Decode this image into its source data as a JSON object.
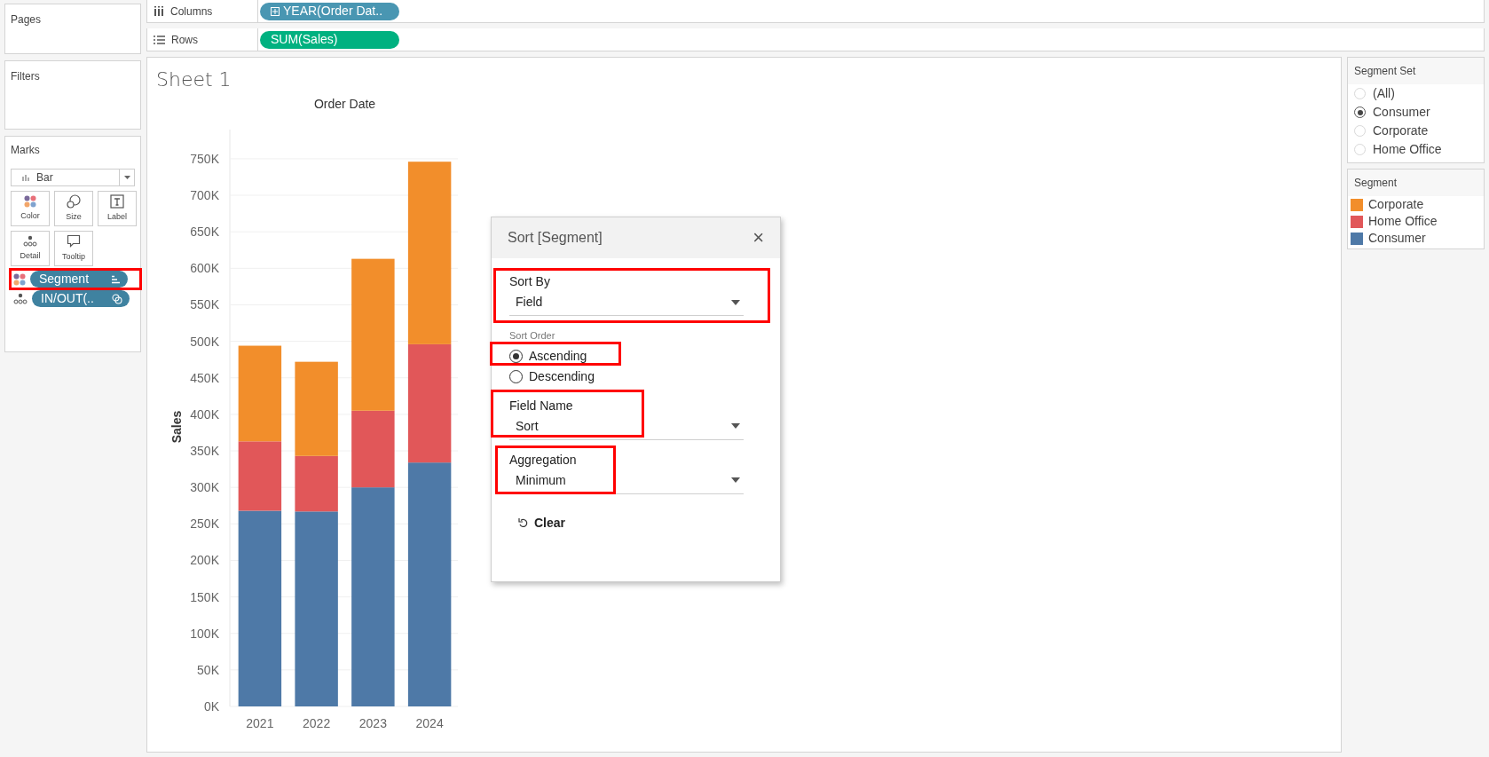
{
  "pages": {
    "title": "Pages"
  },
  "shelves": [
    {
      "kind": "columns",
      "label": "Columns",
      "pill": "YEAR(Order Dat.."
    },
    {
      "kind": "rows",
      "label": "Rows",
      "pill": "SUM(Sales)"
    }
  ],
  "filters": {
    "title": "Filters"
  },
  "marks": {
    "title": "Marks",
    "mark_type": "Bar",
    "cards": [
      {
        "kind": "color",
        "label": "Color"
      },
      {
        "kind": "size",
        "label": "Size"
      },
      {
        "kind": "label",
        "label": "Label"
      },
      {
        "kind": "detail",
        "label": "Detail"
      },
      {
        "kind": "tooltip",
        "label": "Tooltip"
      }
    ],
    "fields": [
      {
        "kind": "color",
        "label": "Segment",
        "annotated": true
      },
      {
        "kind": "detail",
        "label": "IN/OUT(..",
        "annotated": false
      }
    ]
  },
  "sheet": {
    "title": "Sheet 1",
    "chart_data": {
      "type": "bar",
      "title": "Order Date",
      "ylabel": "Sales",
      "stacked": true,
      "categories": [
        "2021",
        "2022",
        "2023",
        "2024"
      ],
      "series": [
        {
          "name": "Consumer",
          "color": "#4e79a7",
          "values": [
            268,
            267,
            300,
            334
          ]
        },
        {
          "name": "Home Office",
          "color": "#e15759",
          "values": [
            95,
            76,
            105,
            162
          ]
        },
        {
          "name": "Corporate",
          "color": "#f28e2b",
          "values": [
            131,
            129,
            208,
            250
          ]
        }
      ],
      "ylim": [
        0,
        790
      ],
      "grid": true,
      "yticks": [
        {
          "value": 0,
          "label": "0K"
        },
        {
          "value": 50,
          "label": "50K"
        },
        {
          "value": 100,
          "label": "100K"
        },
        {
          "value": 150,
          "label": "150K"
        },
        {
          "value": 200,
          "label": "200K"
        },
        {
          "value": 250,
          "label": "250K"
        },
        {
          "value": 300,
          "label": "300K"
        },
        {
          "value": 350,
          "label": "350K"
        },
        {
          "value": 400,
          "label": "400K"
        },
        {
          "value": 450,
          "label": "450K"
        },
        {
          "value": 500,
          "label": "500K"
        },
        {
          "value": 550,
          "label": "550K"
        },
        {
          "value": 600,
          "label": "600K"
        },
        {
          "value": 650,
          "label": "650K"
        },
        {
          "value": 700,
          "label": "700K"
        },
        {
          "value": 750,
          "label": "750K"
        }
      ]
    }
  },
  "dialog": {
    "title": "Sort [Segment]",
    "close": "×",
    "sort_by": {
      "label": "Sort By",
      "value": "Field",
      "annotated": true
    },
    "sort_order": {
      "label": "Sort Order",
      "options": [
        {
          "label": "Ascending",
          "selected": true,
          "annotated": true
        },
        {
          "label": "Descending",
          "selected": false,
          "annotated": false
        }
      ]
    },
    "field_name": {
      "label": "Field Name",
      "value": "Sort",
      "annotated": true
    },
    "aggregation": {
      "label": "Aggregation",
      "value": "Minimum",
      "annotated": true
    },
    "clear": "Clear"
  },
  "segment_set": {
    "title": "Segment Set",
    "options": [
      {
        "label": "(All)",
        "selected": false
      },
      {
        "label": "Consumer",
        "selected": true
      },
      {
        "label": "Corporate",
        "selected": false
      },
      {
        "label": "Home Office",
        "selected": false
      }
    ]
  },
  "legend": {
    "title": "Segment"
  }
}
